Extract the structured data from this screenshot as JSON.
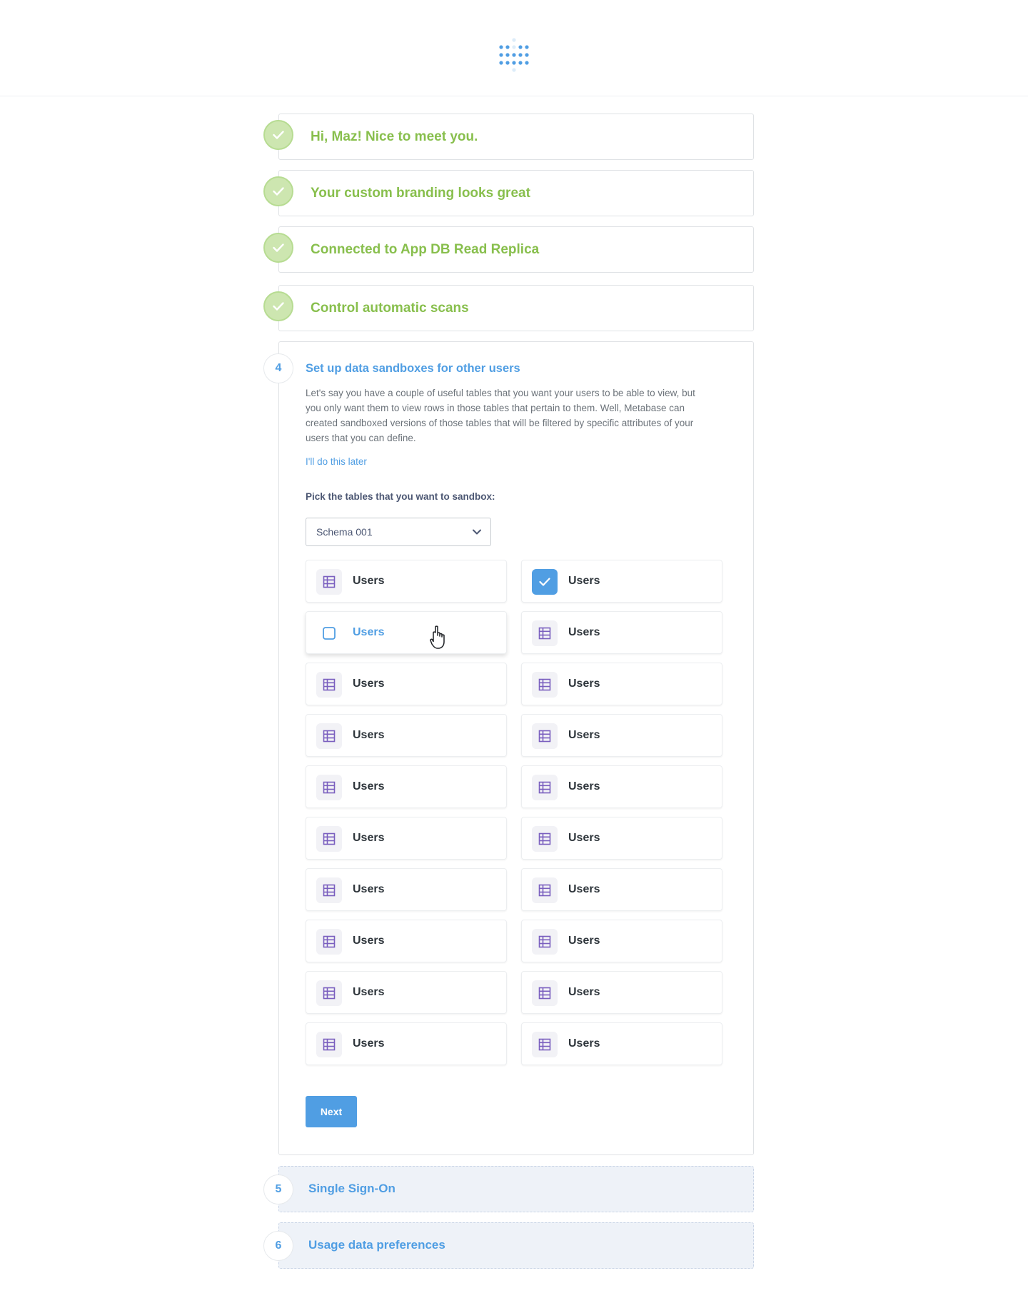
{
  "app": {
    "logo_icon": "metabase-logo-icon"
  },
  "colors": {
    "brand": "#509ee3",
    "success": "#88bf4d",
    "table_icon": "#7a5fbf"
  },
  "completed_steps": [
    {
      "title": "Hi, Maz! Nice to meet you."
    },
    {
      "title": "Your custom branding looks great"
    },
    {
      "title": "Connected to App DB Read Replica"
    },
    {
      "title": "Control automatic scans"
    }
  ],
  "active_step": {
    "number": "4",
    "title": "Set up data sandboxes for other users",
    "description": "Let's say you have a couple of useful tables that you want your users to be able to view, but you only want them to view rows in those tables that pertain to them. Well, Metabase can created sandboxed versions of those tables that will be filtered by specific attributes of your users that you can define.",
    "skip_link": "I'll do this later",
    "pick_label": "Pick the tables that you want to sandbox:",
    "schema_select": {
      "value": "Schema 001"
    },
    "tables": [
      {
        "label": "Users",
        "state": "default"
      },
      {
        "label": "Users",
        "state": "checked"
      },
      {
        "label": "Users",
        "state": "hover"
      },
      {
        "label": "Users",
        "state": "default"
      },
      {
        "label": "Users",
        "state": "default"
      },
      {
        "label": "Users",
        "state": "default"
      },
      {
        "label": "Users",
        "state": "default"
      },
      {
        "label": "Users",
        "state": "default"
      },
      {
        "label": "Users",
        "state": "default"
      },
      {
        "label": "Users",
        "state": "default"
      },
      {
        "label": "Users",
        "state": "default"
      },
      {
        "label": "Users",
        "state": "default"
      },
      {
        "label": "Users",
        "state": "default"
      },
      {
        "label": "Users",
        "state": "default"
      },
      {
        "label": "Users",
        "state": "default"
      },
      {
        "label": "Users",
        "state": "default"
      },
      {
        "label": "Users",
        "state": "default"
      },
      {
        "label": "Users",
        "state": "default"
      },
      {
        "label": "Users",
        "state": "default"
      },
      {
        "label": "Users",
        "state": "default"
      }
    ],
    "next_label": "Next"
  },
  "pending_steps": [
    {
      "number": "5",
      "title": "Single Sign-On"
    },
    {
      "number": "6",
      "title": "Usage data preferences"
    }
  ]
}
